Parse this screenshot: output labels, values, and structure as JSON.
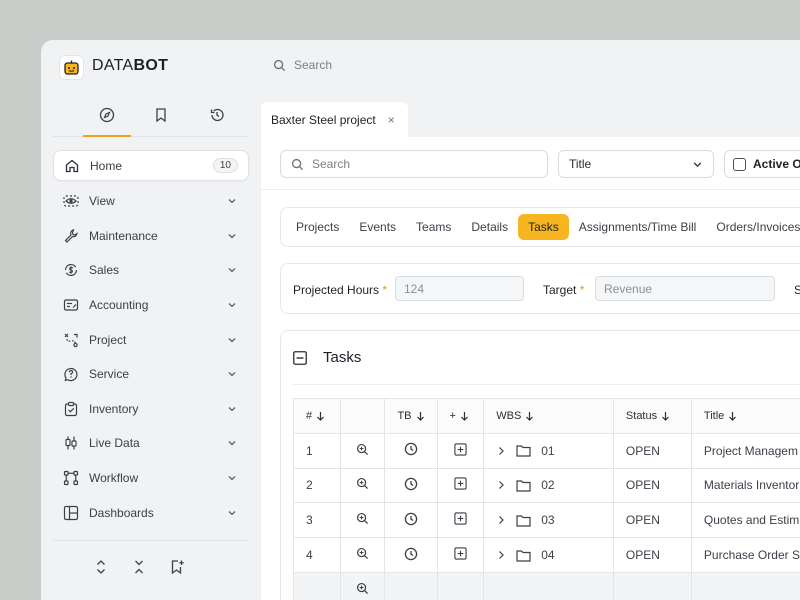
{
  "app": {
    "brand_light": "DATA",
    "brand_bold": "BOT",
    "accent": "#f7b51f",
    "search_placeholder": "Search"
  },
  "sidebar": {
    "tabs": [
      {
        "icon": "compass-icon",
        "active": true
      },
      {
        "icon": "bookmark-icon",
        "active": false
      },
      {
        "icon": "history-icon",
        "active": false
      }
    ],
    "items": [
      {
        "label": "Home",
        "icon": "home-icon",
        "badge": "10",
        "active": true
      },
      {
        "label": "View",
        "icon": "eye-icon"
      },
      {
        "label": "Maintenance",
        "icon": "wrench-icon"
      },
      {
        "label": "Sales",
        "icon": "dollar-cycle-icon"
      },
      {
        "label": "Accounting",
        "icon": "invoice-icon"
      },
      {
        "label": "Project",
        "icon": "route-icon"
      },
      {
        "label": "Service",
        "icon": "help-circle-icon"
      },
      {
        "label": "Inventory",
        "icon": "clipboard-check-icon"
      },
      {
        "label": "Live Data",
        "icon": "candlestick-icon"
      },
      {
        "label": "Workflow",
        "icon": "workflow-icon"
      },
      {
        "label": "Dashboards",
        "icon": "layout-icon"
      }
    ],
    "bottom_icons": [
      "expand-icon",
      "collapse-icon",
      "bookmark-add-icon"
    ]
  },
  "document_tab": {
    "title": "Baxter Steel project",
    "close": "×"
  },
  "toolbar": {
    "search_placeholder": "Search",
    "select_value": "Title",
    "checkbox_label": "Active Or"
  },
  "tabs": [
    "Projects",
    "Events",
    "Teams",
    "Details",
    "Tasks",
    "Assignments/Time Bill",
    "Orders/Invoices"
  ],
  "active_tab": "Tasks",
  "fields": {
    "projected_hours_label": "Projected Hours",
    "projected_hours_value": "124",
    "target_label": "Target",
    "target_value": "Revenue",
    "required_marker": "*",
    "truncated_label": "S"
  },
  "tasks": {
    "title": "Tasks",
    "columns": [
      "#",
      "",
      "TB",
      "+",
      "WBS",
      "Status",
      "Title"
    ],
    "rows": [
      {
        "num": "1",
        "wbs": "01",
        "status": "OPEN",
        "title": "Project Managem"
      },
      {
        "num": "2",
        "wbs": "02",
        "status": "OPEN",
        "title": "Materials Inventor"
      },
      {
        "num": "3",
        "wbs": "03",
        "status": "OPEN",
        "title": "Quotes and Estim"
      },
      {
        "num": "4",
        "wbs": "04",
        "status": "OPEN",
        "title": "Purchase Order S"
      }
    ]
  }
}
